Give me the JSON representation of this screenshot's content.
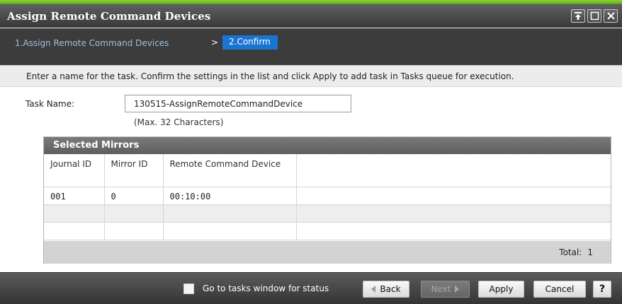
{
  "window": {
    "title": "Assign Remote Command Devices",
    "controls": {
      "pin_icon": "pin-icon",
      "maximize_icon": "maximize-icon",
      "close_icon": "close-icon"
    }
  },
  "breadcrumb": {
    "step1": "1.Assign Remote Command Devices",
    "separator": ">",
    "step2": "2.Confirm",
    "active_color": "#1a75d2"
  },
  "instructions": "Enter a name for the task. Confirm the settings in the list and click Apply to add task in Tasks queue for execution.",
  "task": {
    "label": "Task Name:",
    "value": "130515-AssignRemoteCommandDevice",
    "hint": "(Max. 32 Characters)"
  },
  "mirrors": {
    "title": "Selected Mirrors",
    "columns": [
      "Journal ID",
      "Mirror ID",
      "Remote Command Device",
      ""
    ],
    "rows": [
      [
        "001",
        "0",
        "00:10:00",
        ""
      ],
      [
        "",
        "",
        "",
        ""
      ],
      [
        "",
        "",
        "",
        ""
      ]
    ],
    "total_label": "Total:",
    "total_value": "1"
  },
  "footer": {
    "goto_label": "Go to tasks window for status",
    "goto_checked": false,
    "back": "Back",
    "next": "Next",
    "apply": "Apply",
    "cancel": "Cancel",
    "help": "?"
  },
  "colors": {
    "accent_green": "#58a816",
    "header_dark": "#3a3a3a"
  }
}
